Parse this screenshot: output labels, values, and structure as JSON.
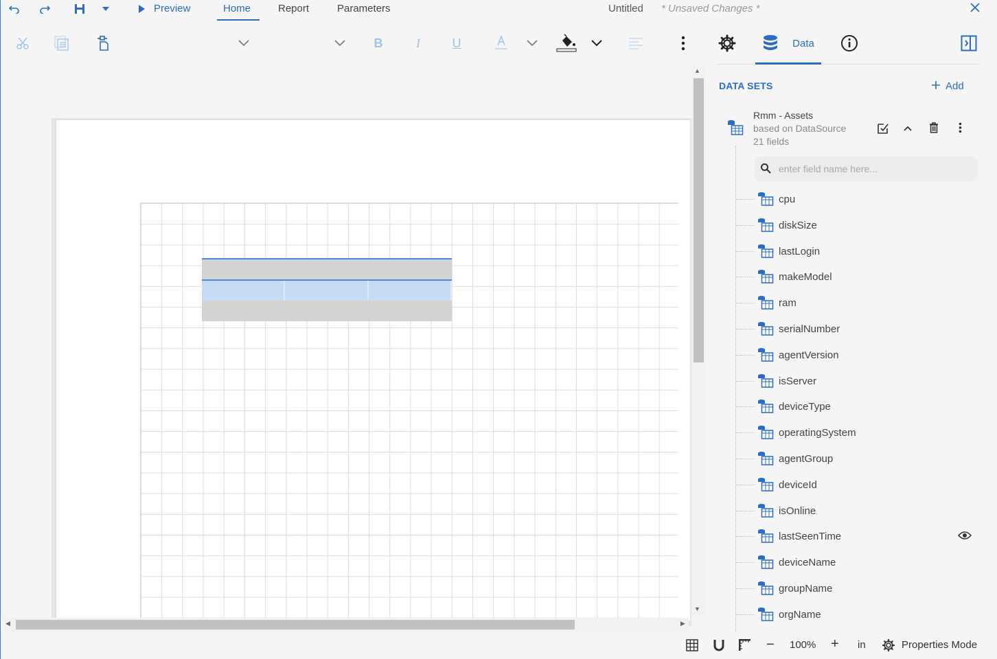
{
  "menu": {
    "preview": "Preview",
    "home": "Home",
    "report": "Report",
    "parameters": "Parameters",
    "title": "Untitled",
    "unsaved": "* Unsaved Changes *"
  },
  "toolbar": {
    "data_tab": "Data"
  },
  "datasets": {
    "title": "DATA SETS",
    "add_label": "Add",
    "dataset": {
      "name": "Rmm - Assets",
      "source": "based on DataSource",
      "count": "21 fields"
    },
    "search_placeholder": "enter field name here...",
    "fields": [
      "cpu",
      "diskSize",
      "lastLogin",
      "makeModel",
      "ram",
      "serialNumber",
      "agentVersion",
      "isServer",
      "deviceType",
      "operatingSystem",
      "agentGroup",
      "deviceId",
      "isOnline",
      "lastSeenTime",
      "deviceName",
      "groupName",
      "orgName"
    ]
  },
  "statusbar": {
    "zoom": "100%",
    "unit": "in",
    "properties_mode": "Properties Mode"
  },
  "colors": {
    "accent": "#2b6cc4",
    "selection": "#c6dcf5"
  }
}
